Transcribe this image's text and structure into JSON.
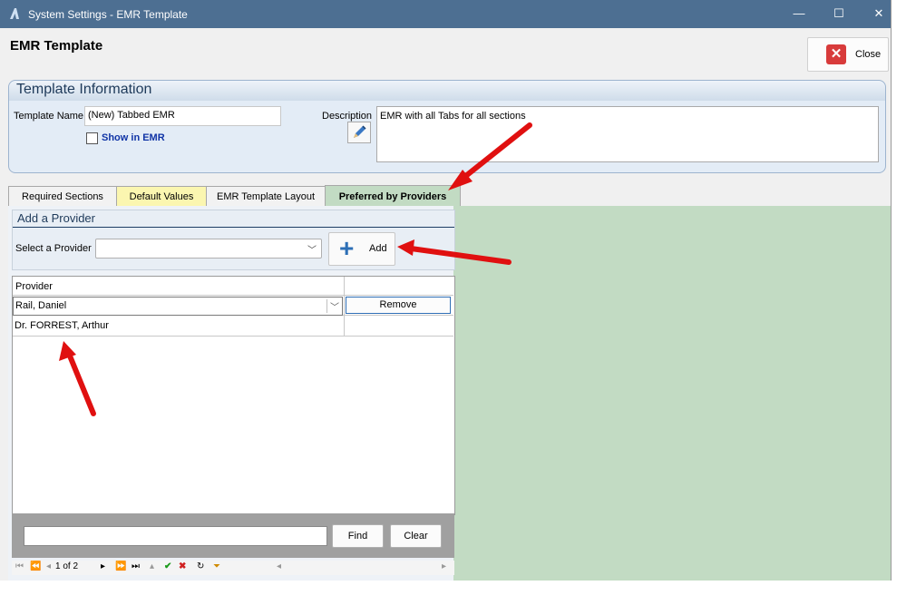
{
  "window": {
    "title": "System Settings - EMR Template",
    "minimize_glyph": "—",
    "maximize_glyph": "☐",
    "close_glyph": "✕"
  },
  "header": {
    "title": "EMR Template",
    "close_label": "Close"
  },
  "template_info": {
    "section_title": "Template Information",
    "name_label": "Template Name",
    "name_value": "(New) Tabbed EMR",
    "show_in_emr_label": "Show in EMR",
    "show_in_emr_checked": false,
    "description_label": "Description",
    "description_value": "EMR with all Tabs for all sections"
  },
  "tabs": [
    {
      "label": "Required Sections",
      "active": false
    },
    {
      "label": "Default Values",
      "active": false
    },
    {
      "label": "EMR Template Layout",
      "active": false
    },
    {
      "label": "Preferred by Providers",
      "active": true
    }
  ],
  "add_provider": {
    "section_title": "Add a Provider",
    "select_label": "Select a Provider",
    "select_value": "",
    "add_label": "Add"
  },
  "grid": {
    "column_header": "Provider",
    "rows": [
      {
        "provider": "Rail, Daniel",
        "action": "Remove"
      },
      {
        "provider": "Dr. FORREST, Arthur",
        "action": ""
      }
    ]
  },
  "search": {
    "find_label": "Find",
    "clear_label": "Clear",
    "value": ""
  },
  "pager": {
    "text": "1 of 2"
  },
  "colors": {
    "titlebar": "#4d6f92",
    "active_tab": "#c2dbc3",
    "default_values_tab": "#fbf6b0",
    "annotation_arrow": "#e01010"
  }
}
